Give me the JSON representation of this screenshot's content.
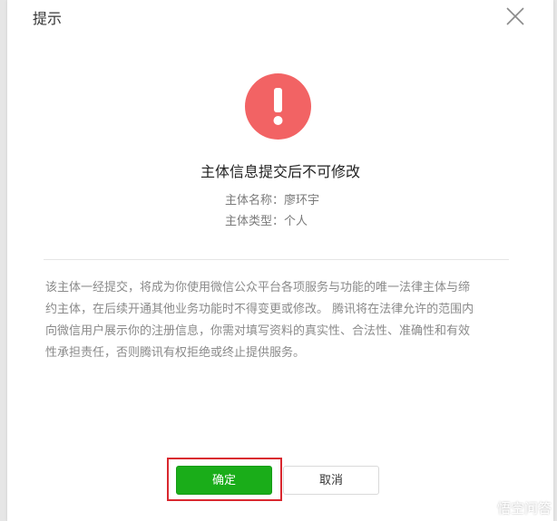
{
  "dialog": {
    "title": "提示",
    "close_icon": "close-icon"
  },
  "status": {
    "icon": "warning-icon",
    "color": "#f26364",
    "headline": "主体信息提交后不可修改"
  },
  "subject": {
    "name_label": "主体名称：",
    "name_value": "廖环宇",
    "type_label": "主体类型：",
    "type_value": "个人"
  },
  "notice": {
    "lines": [
      "该主体一经提交，将成为你使用微信公众平台各项服务与功能的唯一法律主体与缔",
      "约主体，在后续开通其他业务功能时不得变更或修改。 腾讯将在法律允许的范围内",
      "向微信用户展示你的注册信息，你需对填写资料的真实性、合法性、准确性和有效",
      "性承担责任，否则腾讯有权拒绝或终止提供服务。"
    ]
  },
  "actions": {
    "confirm_label": "确定",
    "cancel_label": "取消",
    "confirm_color": "#1aad19",
    "highlight_color": "#d9282f"
  },
  "watermark": {
    "text": "悟空问答"
  }
}
